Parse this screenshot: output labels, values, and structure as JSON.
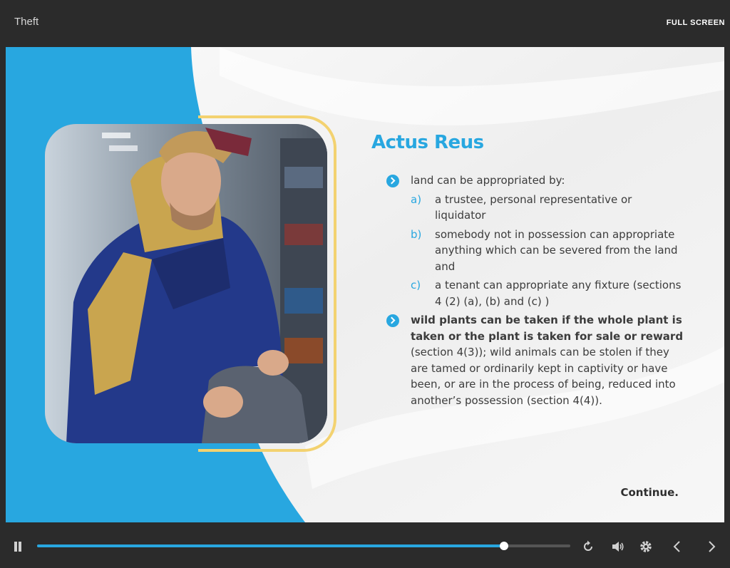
{
  "window": {
    "title": "Theft",
    "fullscreen_label": "FULL SCREEN"
  },
  "slide": {
    "heading": "Actus Reus",
    "bullet1": {
      "text": "land can be appropriated by:"
    },
    "sub_items": [
      {
        "letter": "a)",
        "text": "a trustee, personal representative or liquidator"
      },
      {
        "letter": "b)",
        "text": "somebody not in possession can appropriate anything which can be severed from the land and"
      },
      {
        "letter": "c)",
        "text": "a tenant can appropriate any fixture (sections 4 (2) (a), (b) and (c) )"
      }
    ],
    "bullet2": {
      "bold": "wild plants can be taken if the whole plant is taken or the plant is taken for sale or reward",
      "rest": " (section 4(3)); wild animals can be stolen if they are tamed or ordinarily kept in captivity or have been, or are in the process of being, reduced into another’s possession (section 4(4))."
    },
    "continue_label": "Continue."
  },
  "player": {
    "progress": 0.875,
    "icons": [
      "pause-icon",
      "replay-icon",
      "volume-icon",
      "settings-gear-icon",
      "chevron-left-icon",
      "chevron-right-icon"
    ]
  },
  "colors": {
    "accent": "#28a7e0",
    "frame": "#f3d270",
    "bar": "#2b2b2b"
  }
}
